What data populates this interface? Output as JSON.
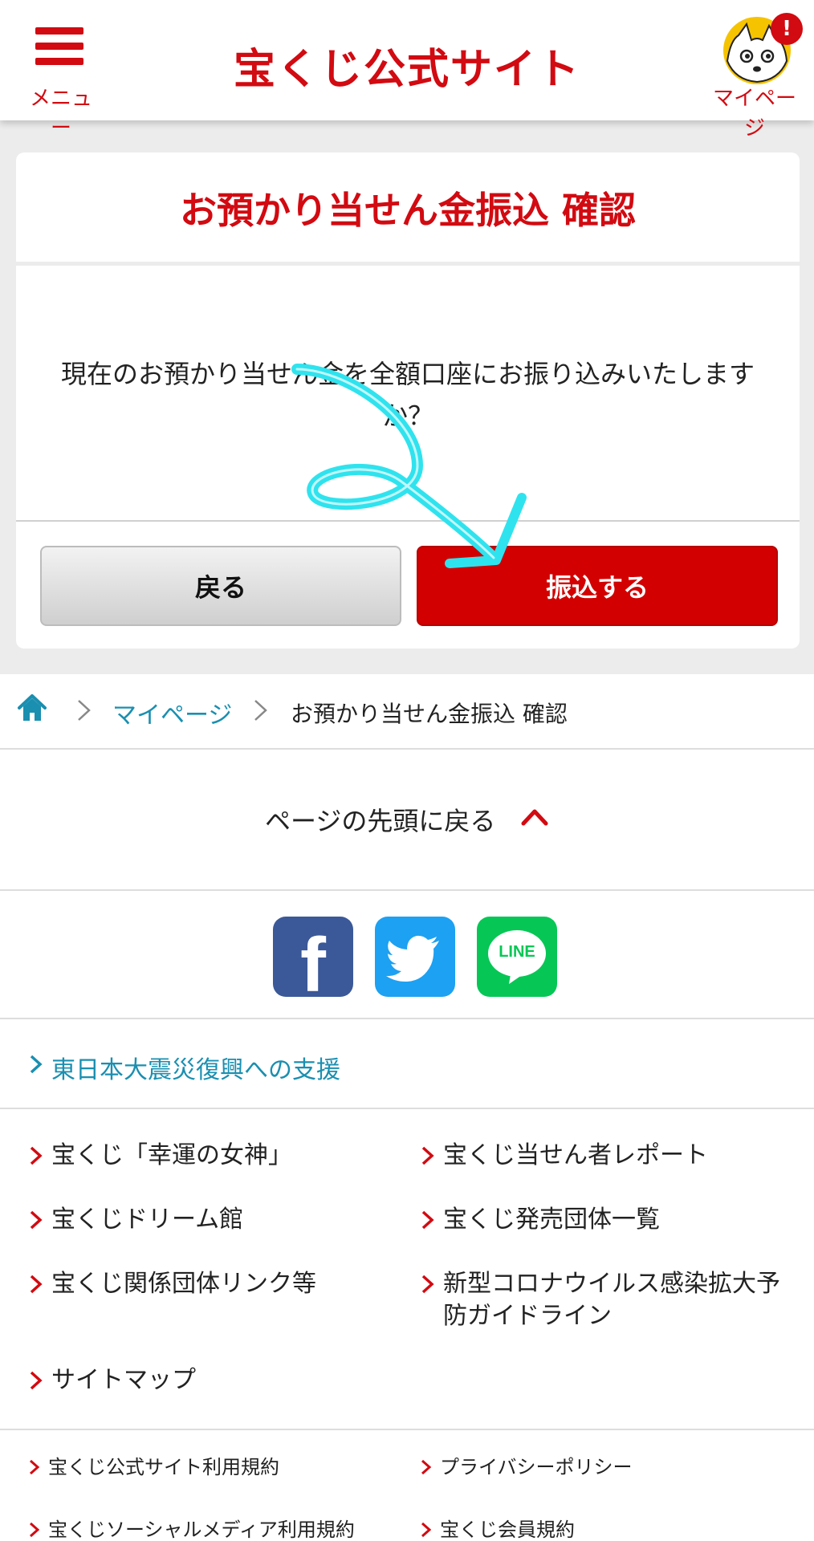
{
  "header": {
    "menu_label": "メニュー",
    "logo_text": "宝くじ公式サイト",
    "mypage_label": "マイページ",
    "notification_badge": "!"
  },
  "dialog": {
    "title": "お預かり当せん金振込 確認",
    "message": "現在のお預かり当せん金を全額口座にお振り込みいたしますか？",
    "back_button": "戻る",
    "transfer_button": "振込する"
  },
  "breadcrumb": {
    "mypage": "マイページ",
    "current": "お預かり当せん金振込 確認"
  },
  "back_to_top": "ページの先頭に戻る",
  "social": {
    "facebook": "f",
    "line": "LINE"
  },
  "support_link": "東日本大震災復興への支援",
  "links": [
    "宝くじ「幸運の女神」",
    "宝くじ当せん者レポート",
    "宝くじドリーム館",
    "宝くじ発売団体一覧",
    "宝くじ関係団体リンク等",
    "新型コロナウイルス感染拡大予防ガイドライン",
    "サイトマップ"
  ],
  "small_links": [
    "宝くじ公式サイト利用規約",
    "プライバシーポリシー",
    "宝くじソーシャルメディア利用規約",
    "宝くじ会員規約"
  ],
  "colors": {
    "brand_red": "#d20a11",
    "link_blue": "#1a8fb0",
    "annotation_cyan": "#2fe3ee"
  }
}
